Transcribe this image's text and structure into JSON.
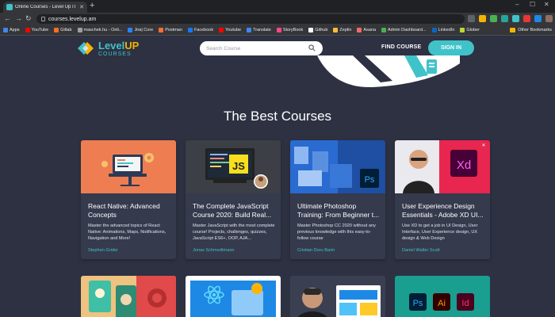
{
  "browser": {
    "tab_title": "Online Courses - Level Up IT C",
    "url": "courses.levelup.am",
    "new_tab": "+",
    "window_controls": {
      "minimize": "–",
      "maximize": "☐",
      "close": "✕"
    },
    "bookmarks": [
      {
        "label": "Apps",
        "color": "#4285f4"
      },
      {
        "label": "YouTube",
        "color": "#ff0000"
      },
      {
        "label": "Gitlab",
        "color": "#fc6d26"
      },
      {
        "label": "maschek.hu - Onli...",
        "color": "#9e9e9e"
      },
      {
        "label": "Jira| Core",
        "color": "#2684ff"
      },
      {
        "label": "Postman",
        "color": "#ff6c37"
      },
      {
        "label": "Facebook",
        "color": "#1877f2"
      },
      {
        "label": "Youtube",
        "color": "#ff0000"
      },
      {
        "label": "Translate",
        "color": "#4285f4"
      },
      {
        "label": "StoryBook",
        "color": "#ff4785"
      },
      {
        "label": "Github",
        "color": "#ffffff"
      },
      {
        "label": "Zeplin",
        "color": "#fdbd39"
      },
      {
        "label": "Asana",
        "color": "#f06a6a"
      },
      {
        "label": "Admin Dashboard...",
        "color": "#4caf50"
      },
      {
        "label": "LinkedIn",
        "color": "#0a66c2"
      },
      {
        "label": "Glober",
        "color": "#bfd730"
      }
    ],
    "other_bookmarks": "Other Bookmarks"
  },
  "header": {
    "logo_level": "Level",
    "logo_up": "UP",
    "logo_courses": "COURSES",
    "search_placeholder": "Search Course",
    "find_course": "FIND COURSE",
    "sign_in": "SIGN IN"
  },
  "section_title": "The Best Courses",
  "courses": [
    {
      "title": "React Native: Advanced Concepts",
      "description": "Master the advanced topics of React Native: Animations, Maps, Notifications, Navigation and More!",
      "author": "Stephen Grider"
    },
    {
      "title": "The Complete JavaScript Course 2020: Build Real...",
      "description": "Master JavaScript with the most complete course! Projects, challenges, quizzes, JavaScript ES6+, OOP, AJA...",
      "author": "Jonas Schmedtmann",
      "thumb_badge": "JS"
    },
    {
      "title": "Ultimate Photoshop Training: From Beginner t...",
      "description": "Master Photoshop CC 2020 without any previous knowledge with this easy-to-follow course",
      "author": "Cristian Doru Barin",
      "thumb_badge": "Ps"
    },
    {
      "title": "User Experience Design Essentials - Adobe XD UI...",
      "description": "Use XD to get a job in UI Design, User Interface, User Experience design, UX design & Web Design",
      "author": "Daniel Walter Scott",
      "thumb_badge": "Xd"
    }
  ],
  "row2_badges": [
    "Ps",
    "Ai",
    "Id"
  ],
  "colors": {
    "background": "#2d3142",
    "card": "#363a4d",
    "accent_teal": "#3fc3c9",
    "accent_yellow": "#f4b400"
  }
}
